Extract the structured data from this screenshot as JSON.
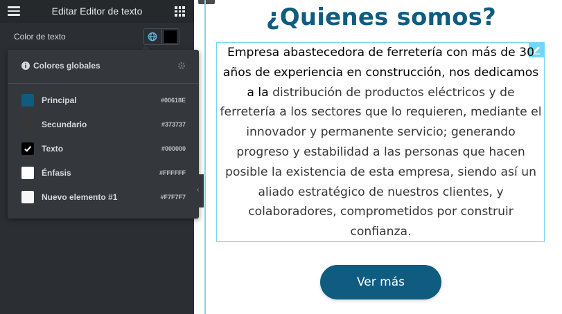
{
  "panel": {
    "title": "Editar Editor de texto",
    "color_label": "Color de texto"
  },
  "popover": {
    "title": "Colores globales",
    "items": [
      {
        "name": "Principal",
        "hex": "#00618E",
        "color": "#0f5c80",
        "selected": false
      },
      {
        "name": "Secundario",
        "hex": "#373737",
        "color": "#373737",
        "selected": false
      },
      {
        "name": "Texto",
        "hex": "#000000",
        "color": "#000000",
        "selected": true
      },
      {
        "name": "Énfasis",
        "hex": "#FFFFFF",
        "color": "#ffffff",
        "selected": false
      },
      {
        "name": "Nuevo elemento #1",
        "hex": "#F7F7F7",
        "color": "#f7f7f7",
        "selected": false
      }
    ]
  },
  "preview": {
    "heading": "¿Quienes somos?",
    "paragraph_lead": "Empresa abastecedora de ferretería con más de 30 años de experiencia en construcción, nos dedicamos a la",
    "paragraph_rest": " distribución de productos eléctricos y de ferretería a los sectores que lo requieren, mediante el innovador y permanente servicio; generando progreso y estabilidad a las personas que hacen posible la existencia de esta empresa, siendo así un aliado estratégico de nuestros clientes, y colaboradores, comprometidos por construir confianza.",
    "button_label": "Ver más"
  },
  "colors": {
    "panel_bg": "#2b2f33",
    "accent_blue": "#0f5c80",
    "selection_cyan": "#71d7f7"
  },
  "icons": [
    "hamburger-icon",
    "apps-grid-icon",
    "globe-icon",
    "info-icon",
    "gear-icon",
    "check-icon",
    "pencil-icon",
    "collapse-arrow-icon"
  ]
}
